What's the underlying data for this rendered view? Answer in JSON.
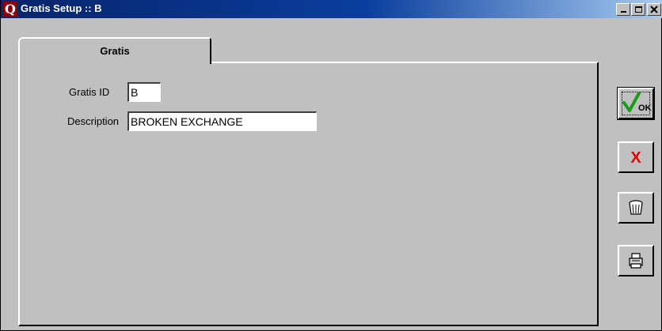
{
  "window": {
    "app_icon_letter": "Q",
    "title": "Gratis Setup :: B"
  },
  "tabs": [
    {
      "label": "Gratis",
      "active": true
    }
  ],
  "form": {
    "gratis_id": {
      "label": "Gratis ID",
      "value": "B"
    },
    "description": {
      "label": "Description",
      "value": "BROKEN EXCHANGE"
    }
  },
  "buttons": {
    "ok": {
      "icon": "checkmark-icon",
      "label": "OK",
      "color": "#1a9c1a"
    },
    "cancel": {
      "icon": "red-x-icon",
      "glyph": "X",
      "color": "#e00000"
    },
    "delete": {
      "icon": "trash-basket-icon"
    },
    "print": {
      "icon": "printer-icon"
    }
  }
}
